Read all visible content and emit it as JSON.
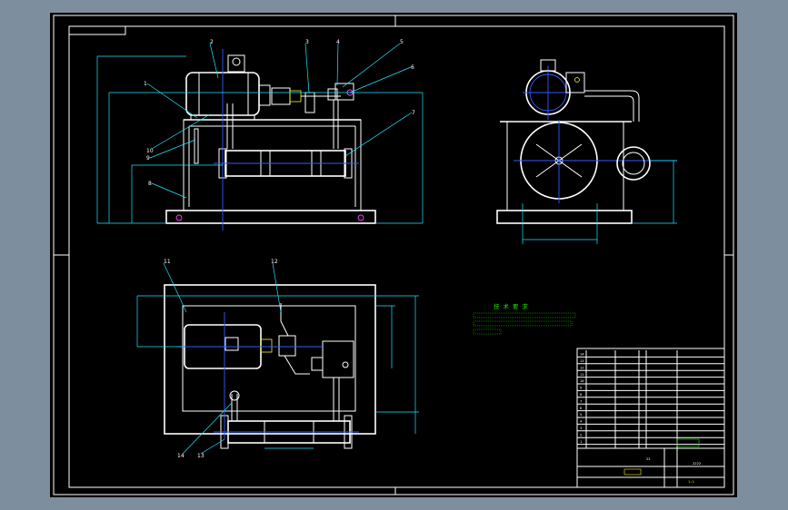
{
  "drawing": {
    "title_box_text": "",
    "part_numbers": [
      "1",
      "2",
      "3",
      "4",
      "5",
      "6",
      "7",
      "8",
      "9",
      "10",
      "11",
      "12",
      "13",
      "14"
    ],
    "dimensions_text": "",
    "technical_requirements": {
      "heading": "技 术 要 求",
      "lines": [
        "",
        ""
      ]
    }
  },
  "title_block": {
    "rows": [
      {
        "no": "14",
        "name": "",
        "std": "",
        "qty": "",
        "mat": "",
        "note": ""
      },
      {
        "no": "13",
        "name": "",
        "std": "",
        "qty": "",
        "mat": "",
        "note": ""
      },
      {
        "no": "12",
        "name": "",
        "std": "",
        "qty": "",
        "mat": "",
        "note": ""
      },
      {
        "no": "11",
        "name": "",
        "std": "",
        "qty": "",
        "mat": "",
        "note": ""
      },
      {
        "no": "10",
        "name": "",
        "std": "",
        "qty": "",
        "mat": "",
        "note": ""
      },
      {
        "no": "9",
        "name": "",
        "std": "",
        "qty": "",
        "mat": "",
        "note": ""
      },
      {
        "no": "8",
        "name": "",
        "std": "",
        "qty": "",
        "mat": "",
        "note": ""
      },
      {
        "no": "7",
        "name": "",
        "std": "",
        "qty": "",
        "mat": "",
        "note": ""
      },
      {
        "no": "6",
        "name": "",
        "std": "",
        "qty": "",
        "mat": "",
        "note": ""
      },
      {
        "no": "5",
        "name": "",
        "std": "",
        "qty": "",
        "mat": "",
        "note": ""
      },
      {
        "no": "4",
        "name": "",
        "std": "",
        "qty": "",
        "mat": "",
        "note": ""
      },
      {
        "no": "3",
        "name": "",
        "std": "",
        "qty": "",
        "mat": "",
        "note": ""
      },
      {
        "no": "2",
        "name": "",
        "std": "",
        "qty": "",
        "mat": "",
        "note": ""
      },
      {
        "no": "1",
        "name": "",
        "std": "",
        "qty": "",
        "mat": "",
        "note": ""
      }
    ],
    "header": {
      "no": "",
      "name": "",
      "std": "",
      "qty": "",
      "mat": "",
      "note": ""
    },
    "drawing_name": "",
    "drawing_number": "",
    "scale": "",
    "mark_left": "22",
    "code": "2222",
    "ratio": "1:1"
  }
}
